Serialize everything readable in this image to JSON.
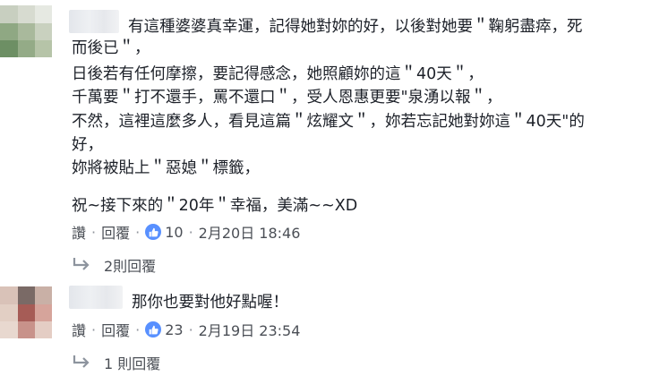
{
  "comments": [
    {
      "lines": [
        "有這種婆婆真幸運，記得她對妳的好，以後對她要＂鞠躬盡瘁，死",
        "而後已＂，",
        "日後若有任何摩擦，要記得感念，她照顧妳的這＂40天＂，",
        "千萬要＂打不還手，罵不還口＂，受人恩惠更要\"泉湧以報＂，",
        "不然，這裡這麼多人，看見這篇＂炫耀文＂，妳若忘記她對妳這＂40天\"的",
        "好，",
        "妳將被貼上＂惡媳＂標籤，",
        "",
        "祝~接下來的＂20年＂幸福，美滿~~XD"
      ],
      "like_label": "讚",
      "reply_label": "回覆",
      "like_count": "10",
      "timestamp": "2月20日 18:46",
      "replies_label": "2則回覆"
    },
    {
      "lines": [
        "那你也要對他好點喔！"
      ],
      "like_label": "讚",
      "reply_label": "回覆",
      "like_count": "23",
      "timestamp": "2月19日 23:54",
      "replies_label": "1 則回覆"
    }
  ],
  "separator": "·",
  "colors": {
    "like_blue": "#5890ff",
    "text": "#1d2129",
    "meta": "#4b4f56"
  }
}
